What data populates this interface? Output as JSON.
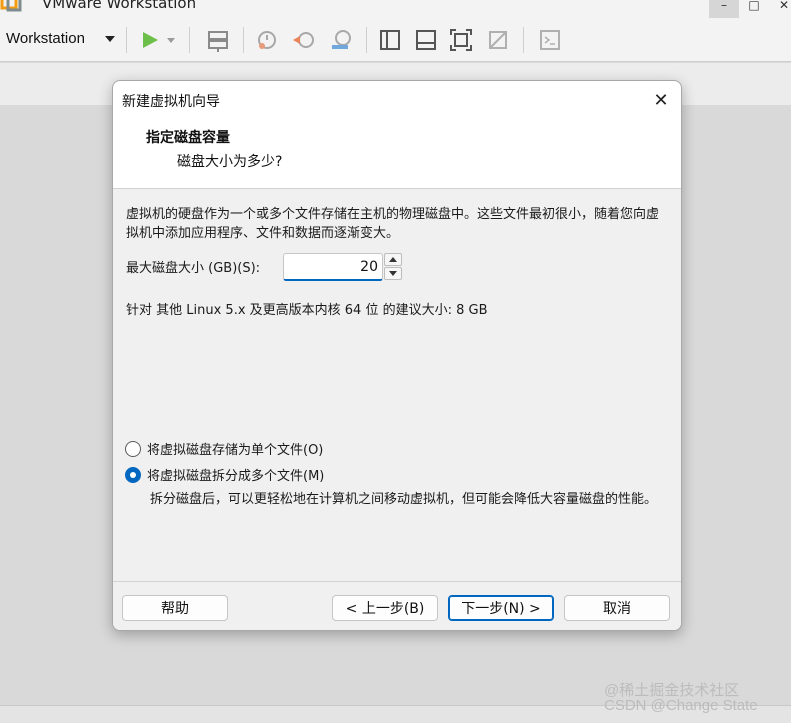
{
  "app": {
    "title": "VMware Workstation",
    "menu_label": "Workstation",
    "window_controls": [
      "–",
      "□",
      "✕"
    ]
  },
  "toolbar": {
    "icons": [
      "play-icon",
      "dropdown-icon",
      "network-icon",
      "snapshot-icon",
      "revert-snapshot-icon",
      "snapshot-manager-icon",
      "single-pane-icon",
      "split-pane-icon",
      "full-screen-icon",
      "unity-icon",
      "console-icon"
    ]
  },
  "dialog": {
    "title": "新建虚拟机向导",
    "close_glyph": "✕",
    "header_title": "指定磁盘容量",
    "header_subtitle": "磁盘大小为多少?",
    "description": "虚拟机的硬盘作为一个或多个文件存储在主机的物理磁盘中。这些文件最初很小，随着您向虚拟机中添加应用程序、文件和数据而逐渐变大。",
    "size_label": "最大磁盘大小 (GB)(S):",
    "size_value": "20",
    "recommendation": "针对 其他 Linux 5.x 及更高版本内核 64 位 的建议大小: 8 GB",
    "options": [
      {
        "label": "将虚拟磁盘存储为单个文件(O)",
        "checked": false
      },
      {
        "label": "将虚拟磁盘拆分成多个文件(M)",
        "checked": true
      }
    ],
    "option_description": "拆分磁盘后，可以更轻松地在计算机之间移动虚拟机，但可能会降低大容量磁盘的性能。",
    "buttons": {
      "help": "帮助",
      "back": "< 上一步(B)",
      "next": "下一步(N) >",
      "cancel": "取消"
    }
  },
  "watermark": "@稀土掘金技术社区\nCSDN @Change State",
  "colors": {
    "accent": "#0067c0",
    "dialog_body": "#f0f0f0",
    "play_green": "#6cc04a"
  }
}
